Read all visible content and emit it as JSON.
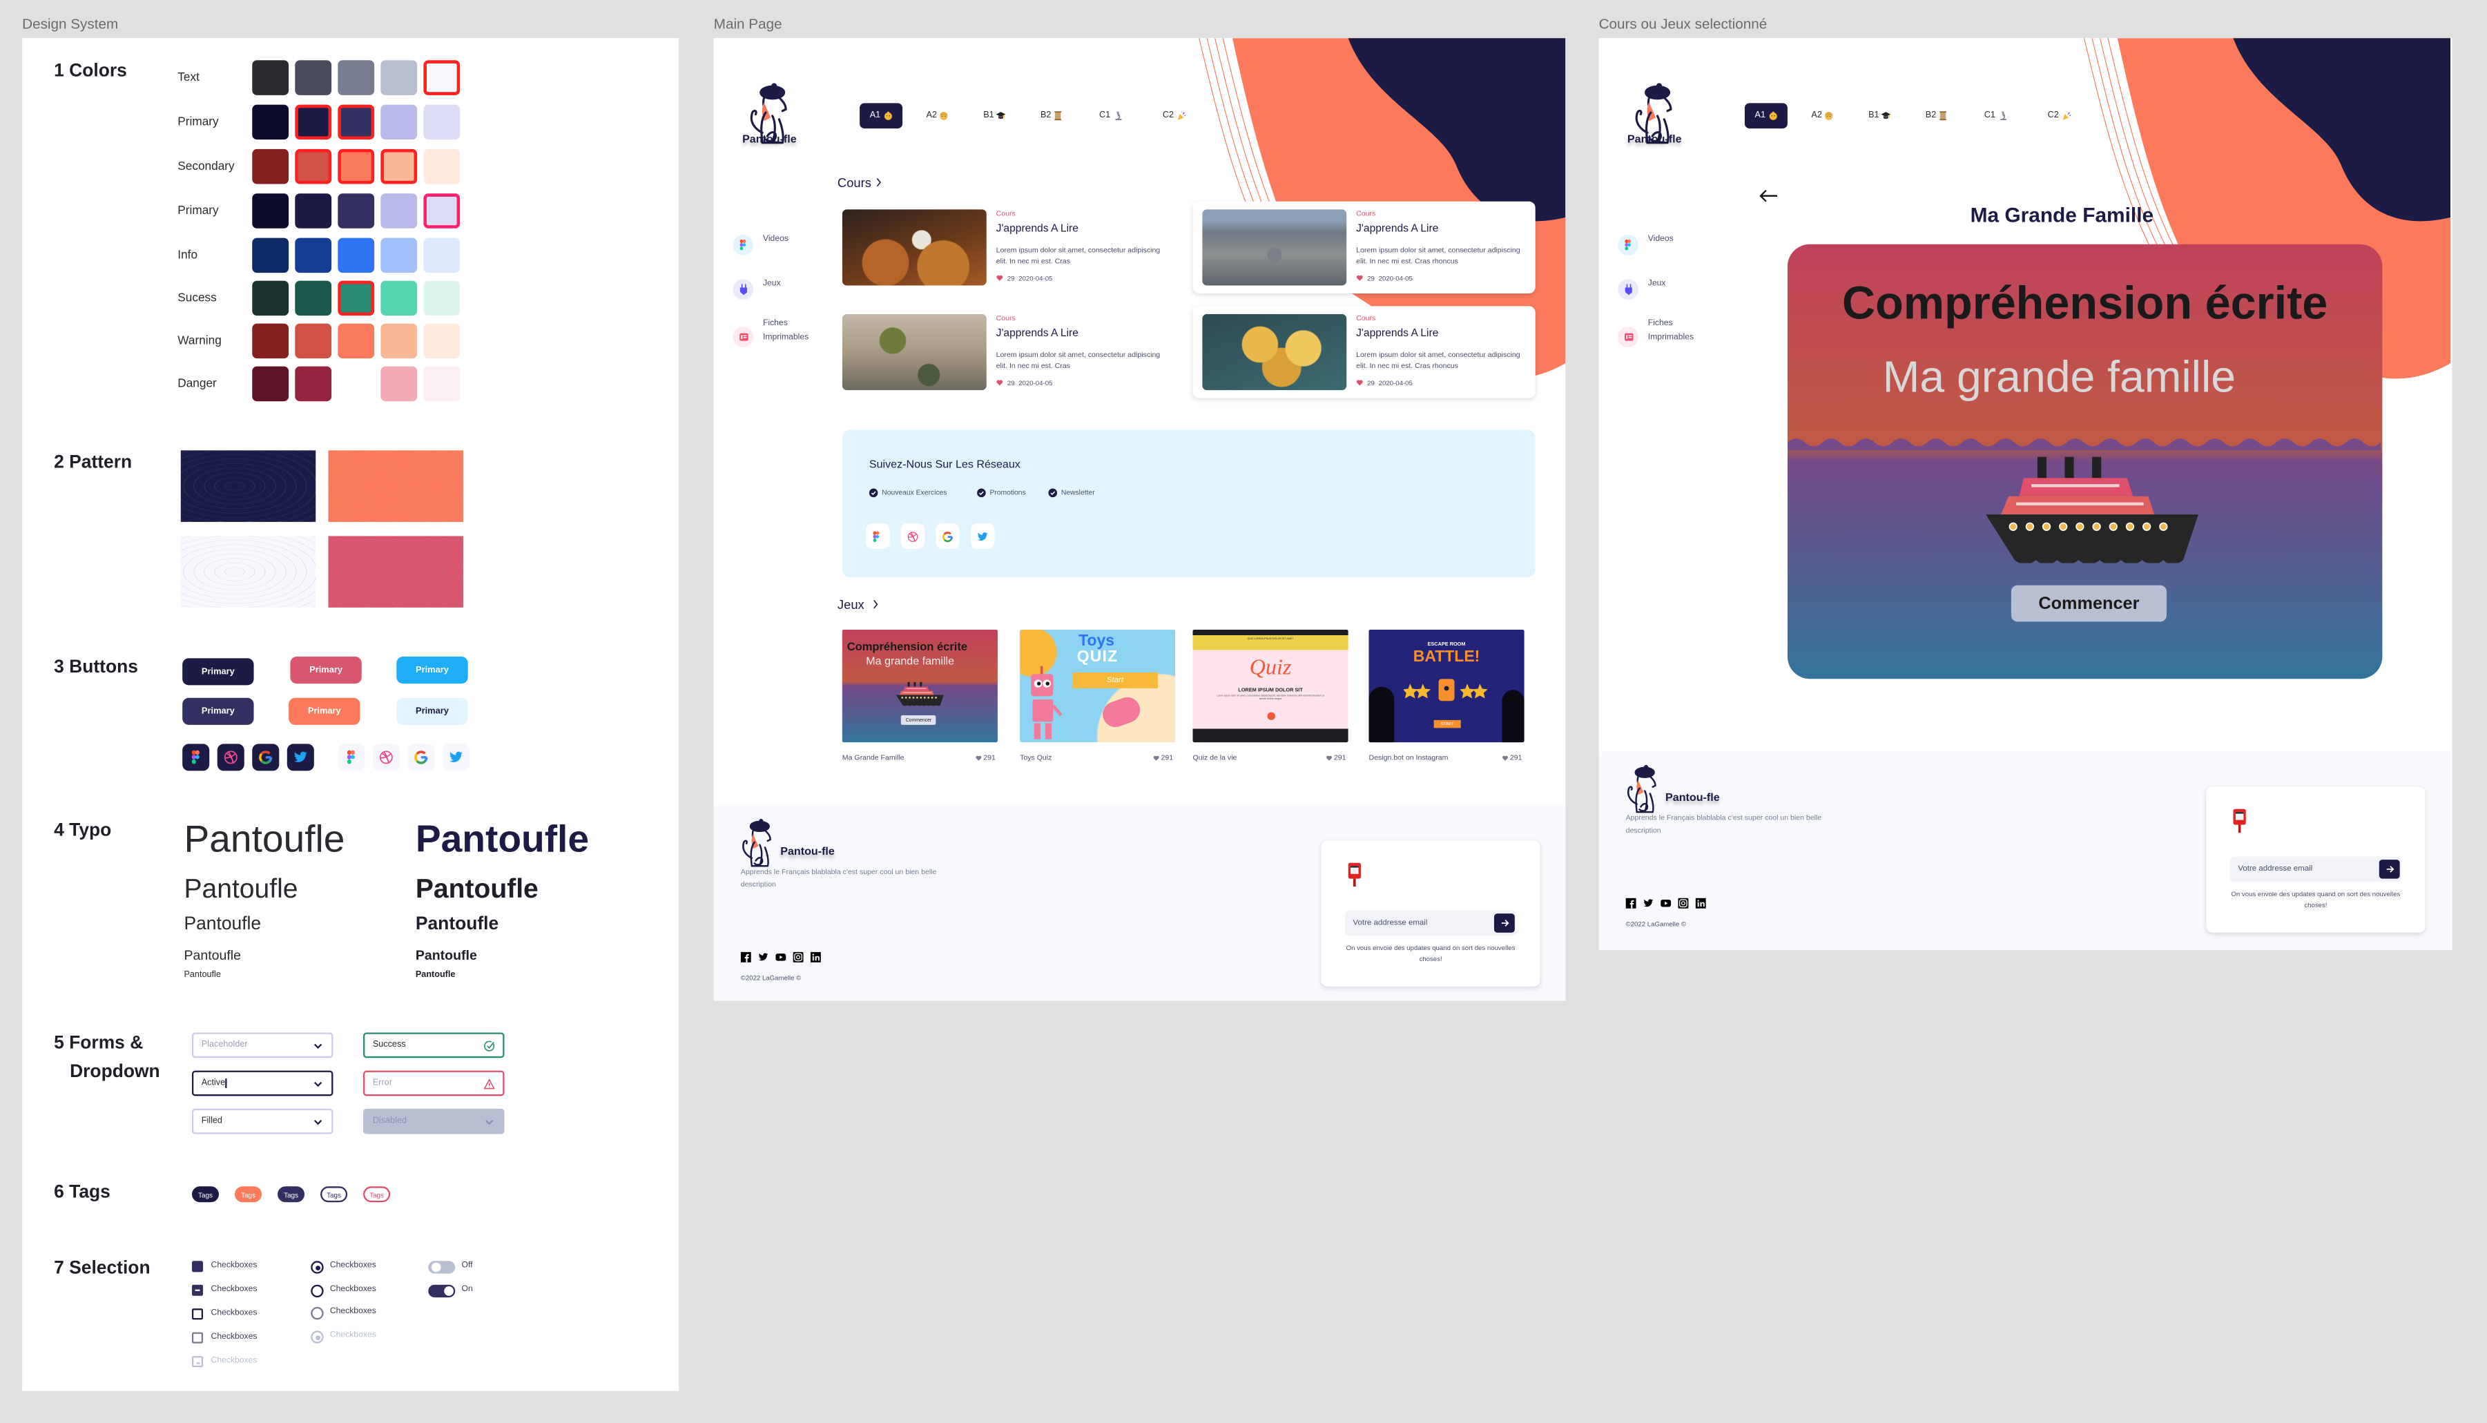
{
  "frames": {
    "design_system": "Design System",
    "main_page": "Main Page",
    "selected": "Cours ou Jeux selectionné"
  },
  "design_system": {
    "colors": {
      "title": "1 Colors",
      "rows": [
        {
          "label": "Text",
          "swatches": [
            "#2a2b30",
            "#4a4e5a",
            "#777c91",
            "#b8bfd3",
            "#f7f8fc"
          ],
          "highlighted": [
            4
          ],
          "highlight_color": "#ff2020"
        },
        {
          "label": "Primary",
          "swatches": [
            "#0d0c2c",
            "#1b1b45",
            "#313060",
            "#b9b9ea",
            "#dcdcf5"
          ],
          "highlighted": [
            1,
            2
          ],
          "highlight_color": "#ff2020"
        },
        {
          "label": "Secondary",
          "swatches": [
            "#861f20",
            "#d05244",
            "#f97a5c",
            "#fab897",
            "#ffeadd"
          ],
          "highlighted": [
            1,
            2,
            3
          ],
          "highlight_color": "#ff2020"
        },
        {
          "label": "Primary",
          "swatches": [
            "#0d0c2c",
            "#1b1b45",
            "#313060",
            "#b9b9ea",
            "#dcdcf5"
          ],
          "highlighted": [
            4
          ],
          "highlight_color": "#ff1f6b"
        },
        {
          "label": "Info",
          "swatches": [
            "#0e2a66",
            "#143d96",
            "#2e74f3",
            "#a0c1f9",
            "#dde9fe"
          ],
          "highlighted": [],
          "highlight_color": "#ff2020"
        },
        {
          "label": "Sucess",
          "swatches": [
            "#1b332e",
            "#19594b",
            "#278c73",
            "#55d6b0",
            "#ddf7ee"
          ],
          "highlighted": [
            2
          ],
          "highlight_color": "#ff2020"
        },
        {
          "label": "Warning",
          "swatches": [
            "#861f20",
            "#d05244",
            "#f97a5c",
            "#fab897",
            "#ffeadd"
          ],
          "highlighted": [],
          "highlight_color": "#ff2020"
        },
        {
          "label": "Danger",
          "swatches": [
            "#5d1429",
            "#96243f",
            null,
            "#f2aab4",
            "#fbeff1"
          ],
          "highlighted": [],
          "highlight_color": "#ff2020"
        }
      ]
    },
    "pattern": {
      "title": "2 Pattern",
      "tiles": [
        "#1c1c48",
        "#fb7a5c",
        "#f6f7fc",
        "#d8566e"
      ]
    },
    "buttons": {
      "title": "3 Buttons",
      "items": [
        {
          "label": "Primary",
          "bg": "#1b1b45",
          "fg": "#ffffff"
        },
        {
          "label": "Primary",
          "bg": "#d8566e",
          "fg": "#ffffff"
        },
        {
          "label": "Primary",
          "bg": "#1eaef8",
          "fg": "#ffffff"
        },
        {
          "label": "Primary",
          "bg": "#313060",
          "fg": "#ffffff"
        },
        {
          "label": "Primary",
          "bg": "#fb7a5c",
          "fg": "#ffffff"
        },
        {
          "label": "Primary",
          "bg": "#e2f5fe",
          "fg": "#1b1b45"
        }
      ],
      "icon_buttons": [
        "figma-icon",
        "dribbble-icon",
        "google-icon",
        "twitter-icon"
      ]
    },
    "typo": {
      "title": "4 Typo",
      "sample": "Pantoufle"
    },
    "forms": {
      "title_line1": "5 Forms &",
      "title_line2": "Dropdown",
      "fields": [
        {
          "text": "Placeholder",
          "state": "placeholder"
        },
        {
          "text": "Success",
          "state": "success"
        },
        {
          "text": "Active",
          "state": "active"
        },
        {
          "text": "Error",
          "state": "error"
        },
        {
          "text": "Filled",
          "state": "filled"
        },
        {
          "text": "Disabled",
          "state": "disabled"
        }
      ]
    },
    "tags": {
      "title": "6 Tags",
      "items": [
        "Tags",
        "Tags",
        "Tags",
        "Tags",
        "Tags"
      ]
    },
    "selection": {
      "title": "7 Selection",
      "checkboxes": [
        {
          "label": "Checkboxes",
          "state": "checked"
        },
        {
          "label": "Checkboxes",
          "state": "indeterminate"
        },
        {
          "label": "Checkboxes",
          "state": "unchecked"
        },
        {
          "label": "Checkboxes",
          "state": "unchecked-light"
        },
        {
          "label": "Checkboxes",
          "state": "disabled"
        }
      ],
      "radios": [
        {
          "label": "Checkboxes",
          "state": "selected"
        },
        {
          "label": "Checkboxes",
          "state": "unselected"
        },
        {
          "label": "Checkboxes",
          "state": "unselected-light"
        },
        {
          "label": "Checkboxes",
          "state": "disabled"
        }
      ],
      "toggles": [
        {
          "label": "Off",
          "on": false
        },
        {
          "label": "On",
          "on": true
        }
      ]
    }
  },
  "header": {
    "brand": "Pantou-fle",
    "levels": [
      {
        "label": "A1",
        "icon": "baby-emoji-icon",
        "active": true
      },
      {
        "label": "A2",
        "icon": "child-emoji-icon",
        "active": false
      },
      {
        "label": "B1",
        "icon": "graduation-cap-emoji-icon",
        "active": false
      },
      {
        "label": "B2",
        "icon": "scroll-emoji-icon",
        "active": false
      },
      {
        "label": "C1",
        "icon": "microscope-emoji-icon",
        "active": false
      },
      {
        "label": "C2",
        "icon": "party-popper-emoji-icon",
        "active": false
      }
    ]
  },
  "sidebar": {
    "items": [
      {
        "label": "Videos",
        "icon": "figma-icon"
      },
      {
        "label": "Jeux",
        "icon": "plug-icon"
      },
      {
        "label": "Fiches",
        "label2": "Imprimables",
        "icon": "document-icon"
      }
    ]
  },
  "main_page": {
    "cours": {
      "title": "Cours",
      "cards": [
        {
          "tag": "Cours",
          "title": "J'apprends A Lire",
          "desc": "Lorem ipsum dolor sit amet, consectetur adipiscing elit. In nec mi est. Cras",
          "likes": "29",
          "date": "2020-04-05",
          "image": "croissants"
        },
        {
          "tag": "Cours",
          "title": "J'apprends A Lire",
          "desc": "Lorem ipsum dolor sit amet, consectetur adipiscing elit. In nec mi est. Cras rhoncus",
          "likes": "29",
          "date": "2020-04-05",
          "image": "paris-aerial"
        },
        {
          "tag": "Cours",
          "title": "J'apprends A Lire",
          "desc": "Lorem ipsum dolor sit amet, consectetur adipiscing elit. In nec mi est. Cras",
          "likes": "29",
          "date": "2020-04-05",
          "image": "paris-street"
        },
        {
          "tag": "Cours",
          "title": "J'apprends A Lire",
          "desc": "Lorem ipsum dolor sit amet, consectetur adipiscing elit. In nec mi est. Cras rhoncus",
          "likes": "29",
          "date": "2020-04-05",
          "image": "crepes"
        }
      ]
    },
    "social": {
      "title": "Suivez-Nous Sur Les Réseaux",
      "checks": [
        "Nouveaux Exercices",
        "Promotions",
        "Newsletter"
      ],
      "icons": [
        "figma-icon",
        "dribbble-icon",
        "google-icon",
        "twitter-icon"
      ]
    },
    "jeux": {
      "title": "Jeux",
      "games": [
        {
          "caption": "Ma Grande Famille",
          "likes": "291",
          "thumb": {
            "title": "Compréhension écrite",
            "subtitle": "Ma grande famille",
            "button": "Commencer"
          }
        },
        {
          "caption": "Toys Quiz",
          "likes": "291",
          "thumb": {
            "line1": "Toys",
            "line2": "QUIZ",
            "button": "Start"
          }
        },
        {
          "caption": "Quiz de la vie",
          "likes": "291",
          "thumb": {
            "banner": "QUIZ LOREM IPSUM DOLOR SIT AMET",
            "title": "Quiz",
            "subtitle": "LOREM IPSUM DOLOR SIT",
            "body": "Lorem ipsum dolor sit amet, consectetuer adipiscing elit, sed diam nonummy nibh euismod tincidunt ut laoreet dolore magna"
          }
        },
        {
          "caption": "Design.bot on Instagram",
          "likes": "291",
          "thumb": {
            "line1": "ESCAPE ROOM",
            "line2": "BATTLE!",
            "button": "START"
          }
        }
      ]
    },
    "footer_note": "On vous envoie des updates quand on sort des nouvelles choses!"
  },
  "footer": {
    "brand": "Pantou-fle",
    "description": "Apprends le Français blablabla c'est super cool un bien belle description",
    "social_icons": [
      "facebook-icon",
      "twitter-icon",
      "youtube-icon",
      "instagram-icon",
      "linkedin-icon"
    ],
    "copyright": "©2022 LaGamelle ©",
    "email_placeholder": "Votre addresse email"
  },
  "selected_page": {
    "title": "Ma Grande Famille",
    "card_title": "Compréhension écrite",
    "card_subtitle": "Ma grande famille",
    "start_button": "Commencer",
    "footer_note": "On vous envole des updates quand on sort des nouvelles choses!"
  },
  "accent_colors": {
    "navy": "#1b1b45",
    "coral": "#fb7a5c",
    "pink": "#d8566e",
    "light_blue": "#e2f5fe"
  }
}
